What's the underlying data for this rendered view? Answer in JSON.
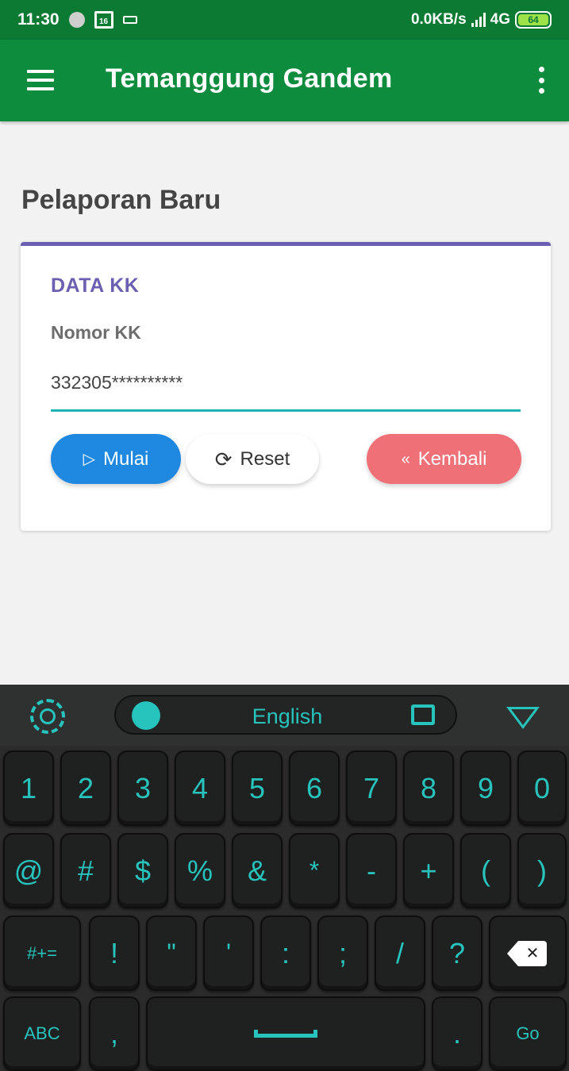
{
  "status_bar": {
    "time": "11:30",
    "home_badge": "16",
    "network_speed": "0.0KB/s",
    "network_type": "4G",
    "battery": "64"
  },
  "app_bar": {
    "title": "Temanggung Gandem"
  },
  "page": {
    "title": "Pelaporan Baru"
  },
  "card": {
    "section_title": "DATA KK",
    "field_label": "Nomor KK",
    "field_value": "332305**********",
    "buttons": {
      "start": "Mulai",
      "reset": "Reset",
      "back": "Kembali"
    }
  },
  "keyboard": {
    "language": "English",
    "row1": [
      "1",
      "2",
      "3",
      "4",
      "5",
      "6",
      "7",
      "8",
      "9",
      "0"
    ],
    "row2": [
      "@",
      "#",
      "$",
      "%",
      "&",
      "*",
      "-",
      "+",
      "(",
      ")"
    ],
    "row3": [
      "#+=",
      "!",
      "\"",
      "'",
      ":",
      ";",
      "/",
      "?"
    ],
    "row4": {
      "abc": "ABC",
      "comma": ",",
      "period": ".",
      "go": "Go"
    }
  },
  "colors": {
    "status_bar": "#0b7a33",
    "app_bar": "#0e8c3e",
    "accent_purple": "#6a5fb0",
    "underline_teal": "#1fb3b3",
    "btn_blue": "#1f88e0",
    "btn_red": "#f07078",
    "keyboard_accent": "#27c4bd"
  }
}
